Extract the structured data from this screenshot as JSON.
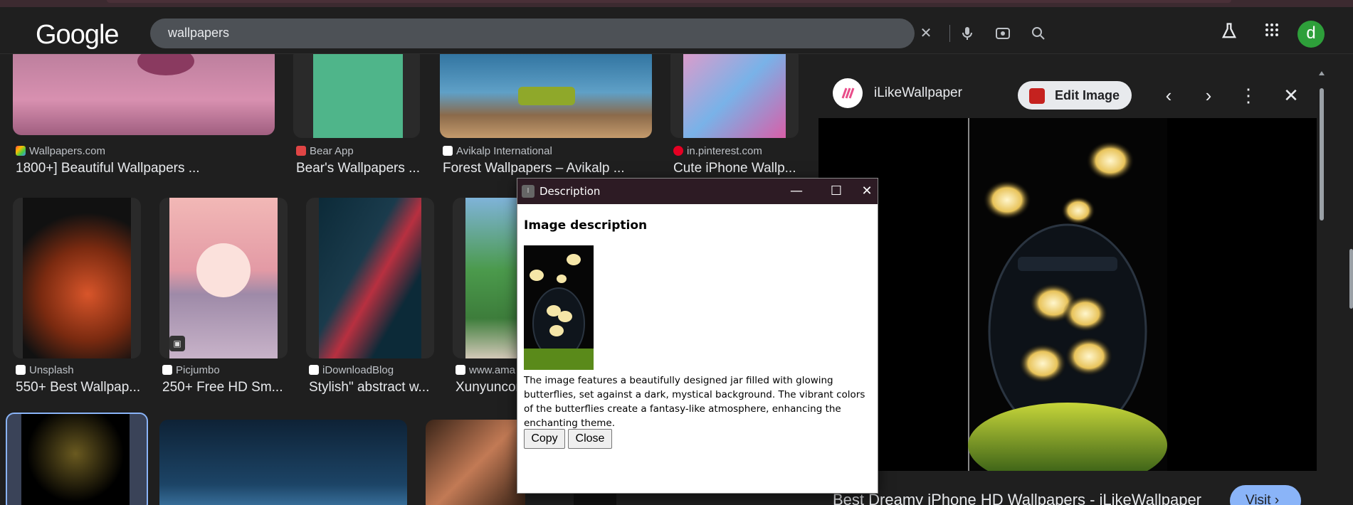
{
  "header": {
    "logo": "Google",
    "search_value": "wallpapers",
    "avatar_letter": "d"
  },
  "results": [
    {
      "source": "Wallpapers.com",
      "title": "1800+] Beautiful Wallpapers ..."
    },
    {
      "source": "Bear App",
      "title": "Bear's Wallpapers ..."
    },
    {
      "source": "Avikalp International",
      "title": "Forest Wallpapers – Avikalp ..."
    },
    {
      "source": "in.pinterest.com",
      "title": "Cute iPhone Wallp..."
    },
    {
      "source": "Unsplash",
      "title": "550+ Best Wallpap..."
    },
    {
      "source": "Picjumbo",
      "title": "250+ Free HD Sm..."
    },
    {
      "source": "iDownloadBlog",
      "title": "Stylish\" abstract w..."
    },
    {
      "source": "www.ama",
      "title": "Xunyuncor"
    }
  ],
  "panel": {
    "site_name": "iLikeWallpaper",
    "edit_label": "Edit Image",
    "page_title": "Best Dreamy iPhone HD Wallpapers - iLikeWallpaper",
    "visit_label": "Visit"
  },
  "dialog": {
    "window_title": "Description",
    "heading": "Image description",
    "description": "The image features a beautifully designed jar filled with glowing butterflies, set against a dark, mystical background. The vibrant colors of the butterflies create a fantasy-like atmosphere, enhancing the enchanting theme.",
    "copy_label": "Copy",
    "close_label": "Close"
  },
  "colors": {
    "accent": "#8ab4f8",
    "avatar_bg": "#2e9f3a",
    "dialog_titlebar": "#2d1b24"
  }
}
